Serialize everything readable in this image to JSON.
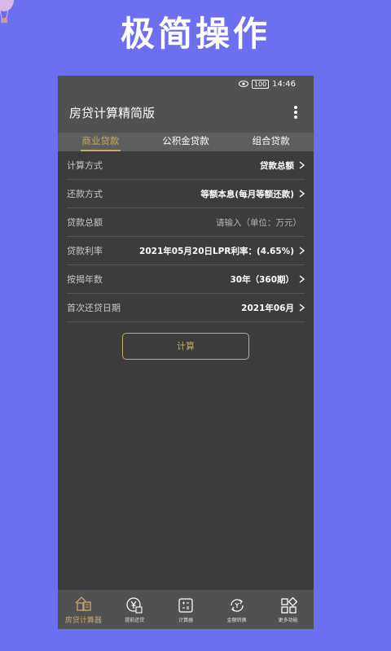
{
  "promo": {
    "headline": "极简操作"
  },
  "status_bar": {
    "battery": "100",
    "time": "14:46"
  },
  "app": {
    "title": "房贷计算精简版"
  },
  "tabs": [
    {
      "label": "商业贷款",
      "active": true
    },
    {
      "label": "公积金贷款",
      "active": false
    },
    {
      "label": "组合贷款",
      "active": false
    }
  ],
  "form": {
    "method": {
      "label": "计算方式",
      "value": "贷款总额"
    },
    "repayment": {
      "label": "还款方式",
      "value": "等额本息(每月等额还款)"
    },
    "amount": {
      "label": "贷款总额",
      "placeholder": "请输入（单位：万元）"
    },
    "rate": {
      "label": "贷款利率",
      "value": "2021年05月20日LPR利率：(4.65%)"
    },
    "years": {
      "label": "按揭年数",
      "value": "30年（360期）"
    },
    "first_date": {
      "label": "首次还贷日期",
      "value": "2021年06月"
    }
  },
  "calculate_label": "计算",
  "bottom_nav": [
    {
      "label": "房贷计算器",
      "icon": "house-calculator-icon",
      "active": true
    },
    {
      "label": "提前还贷",
      "icon": "yuan-coin-icon",
      "active": false
    },
    {
      "label": "计算器",
      "icon": "calculator-icon",
      "active": false
    },
    {
      "label": "金额转换",
      "icon": "currency-exchange-icon",
      "active": false
    },
    {
      "label": "更多功能",
      "icon": "more-functions-icon",
      "active": false
    }
  ],
  "colors": {
    "background": "#6b6ff0",
    "accent": "#c9a968",
    "surface": "#3c3c3c"
  }
}
